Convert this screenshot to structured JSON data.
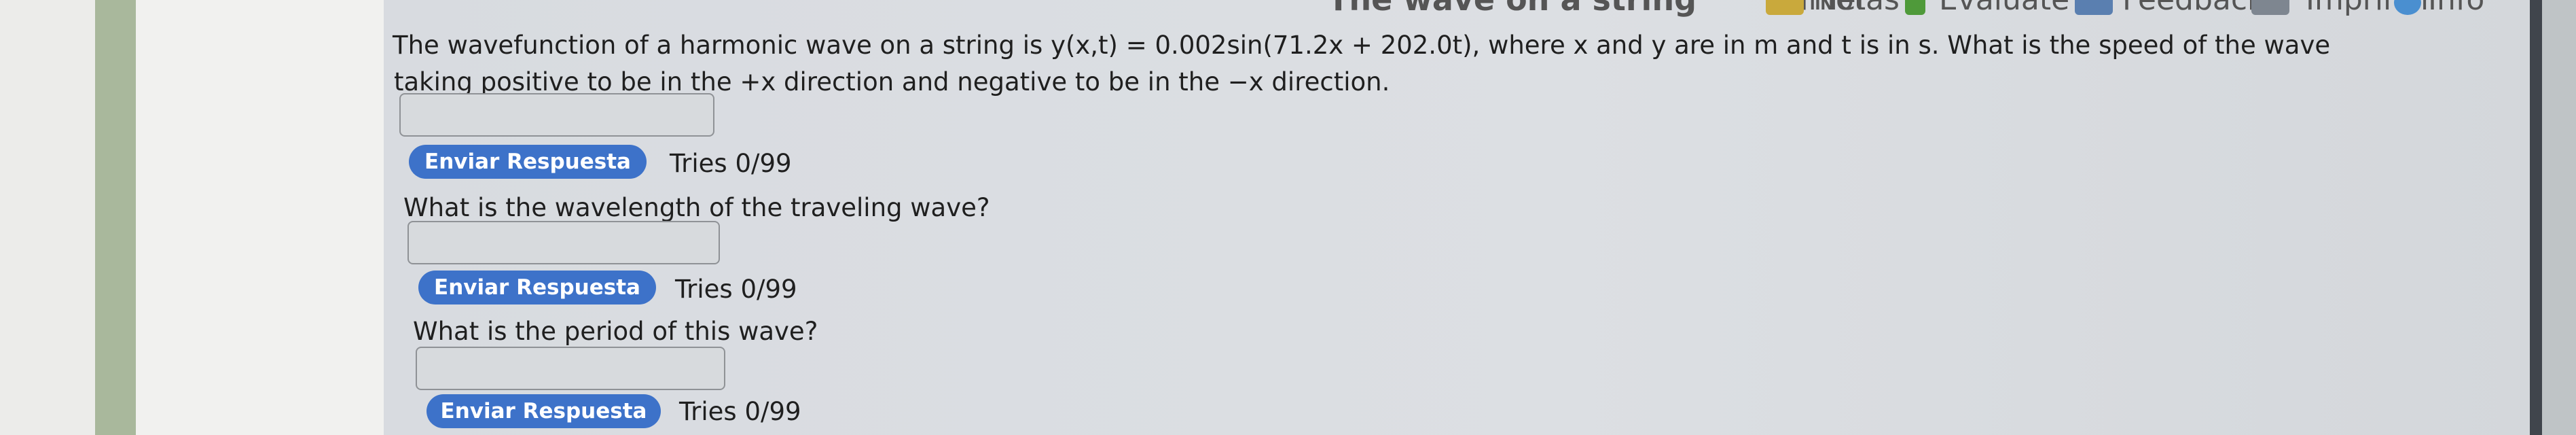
{
  "toolbar": {
    "title": "The wave on a string",
    "timer": "Timer",
    "notas": "Notas",
    "evaluate": "Evaluate",
    "feedback": "Feedback",
    "imprimir": "Imprimir",
    "info": "Info"
  },
  "questions": [
    {
      "text_line1": "The wavefunction of a harmonic wave on a string is y(x,t) = 0.002sin(71.2x + 202.0t), where x and y are in m and t is in s. What is the speed of the wave",
      "text_line2": "taking positive to be in the +x direction and negative to be in the −x direction.",
      "answer_value": "",
      "submit_label": "Enviar Respuesta",
      "tries": "Tries 0/99"
    },
    {
      "text": "What is the wavelength of the traveling wave?",
      "answer_value": "",
      "submit_label": "Enviar Respuesta",
      "tries": "Tries 0/99"
    },
    {
      "text": "What is the period of this wave?",
      "answer_value": "",
      "submit_label": "Enviar Respuesta",
      "tries": "Tries 0/99"
    }
  ],
  "colors": {
    "button": "#3d72c9",
    "screen": "#dadde1",
    "bezel_green": "#a9b89c"
  },
  "icons": [
    "notes-icon",
    "evaluate-icon",
    "feedback-icon",
    "print-icon",
    "info-icon"
  ]
}
